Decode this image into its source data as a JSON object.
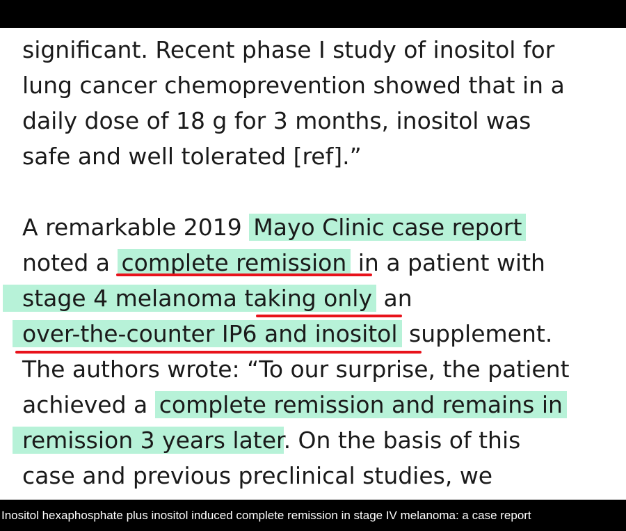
{
  "paragraph_1": {
    "lines": [
      "significant. Recent phase I study of inositol for",
      "lung cancer chemoprevention showed that in a",
      "daily dose of 18 g for 3 months, inositol was",
      "safe and well tolerated [ref].”"
    ]
  },
  "paragraph_2": {
    "l1_a": "A remarkable 2019 ",
    "l1_hl": "Mayo Clinic case report",
    "l2_a": "noted a ",
    "l2_hl": "complete remission",
    "l2_b": " in a patient with",
    "l3_hl": "stage 4 melanoma taking only",
    "l3_b": " an",
    "l4_hl": "over-the-counter IP6 and inositol",
    "l4_b": " supplement.",
    "l5": "The authors wrote: “To our surprise, the patient",
    "l6_a": "achieved a ",
    "l6_hl": "complete remission and remains in",
    "l7_hl": "remission 3 years later",
    "l7_b": ". On the basis of this",
    "l8": "case and previous preclinical studies, we"
  },
  "caption": "Inositol hexaphosphate plus inositol induced complete remission in stage IV melanoma: a case report",
  "colors": {
    "highlight": "#b7f2d8",
    "underline": "#e8121b",
    "text": "#1a1a1a"
  }
}
